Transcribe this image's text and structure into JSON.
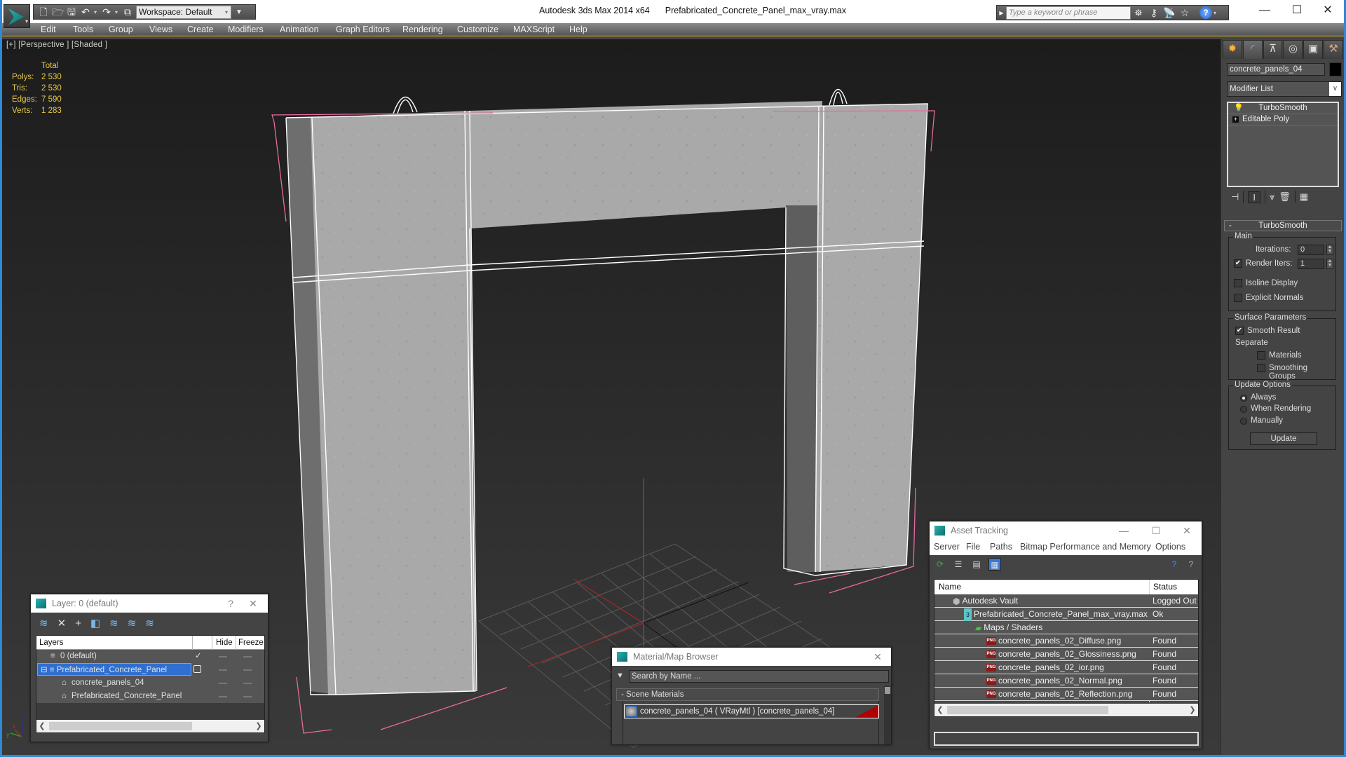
{
  "titlebar": {
    "app_title": "Autodesk 3ds Max  2014 x64",
    "file_name": "Prefabricated_Concrete_Panel_max_vray.max",
    "workspace_label": "Workspace: Default",
    "search_placeholder": "Type a keyword or phrase",
    "quick_access_icons": [
      "new-file-icon",
      "open-file-icon",
      "save-icon",
      "undo-icon",
      "redo-icon",
      "project-folder-icon"
    ],
    "info_icons": [
      "binoculars-icon",
      "key-icon",
      "satellite-icon",
      "star-icon",
      "help-icon"
    ],
    "window_controls": [
      "minimize",
      "maximize",
      "close"
    ]
  },
  "menu": {
    "items": [
      "Edit",
      "Tools",
      "Group",
      "Views",
      "Create",
      "Modifiers",
      "Animation",
      "Graph Editors",
      "Rendering",
      "Customize",
      "MAXScript",
      "Help"
    ]
  },
  "viewport": {
    "label": "[+] [Perspective ] [Shaded ]",
    "stats": {
      "header": "Total",
      "rows": [
        {
          "label": "Polys:",
          "value": "2 530"
        },
        {
          "label": "Tris:",
          "value": "2 530"
        },
        {
          "label": "Edges:",
          "value": "7 590"
        },
        {
          "label": "Verts:",
          "value": "1 283"
        }
      ]
    },
    "axis_labels": {
      "x": "x",
      "y": "y",
      "z": "z"
    },
    "colors": {
      "stats": "#e6c84a",
      "selection_bracket": "#e86aa0",
      "wire": "#ffffff"
    }
  },
  "command_panel": {
    "tabs": [
      "create",
      "modify",
      "hierarchy",
      "motion",
      "display",
      "utilities"
    ],
    "object_name": "concrete_panels_04",
    "object_color": "#000000",
    "modifier_list_label": "Modifier List",
    "stack": [
      {
        "name": "TurboSmooth",
        "icon": "lightbulb-icon"
      },
      {
        "name": "Editable Poly",
        "icon": "expand-plus-icon"
      }
    ],
    "rollout": {
      "title": "TurboSmooth",
      "main_group": "Main",
      "iterations_label": "Iterations:",
      "iterations_value": "0",
      "render_iters_label": "Render Iters:",
      "render_iters_value": "1",
      "render_iters_checked": true,
      "isoline_label": "Isoline Display",
      "isoline_checked": false,
      "explicit_normals_label": "Explicit Normals",
      "explicit_normals_checked": false,
      "surface_group": "Surface Parameters",
      "smooth_result_label": "Smooth Result",
      "smooth_result_checked": true,
      "separate_label": "Separate",
      "materials_label": "Materials",
      "materials_checked": false,
      "smoothing_groups_label": "Smoothing Groups",
      "smoothing_groups_checked": false,
      "update_group": "Update Options",
      "update_options": [
        "Always",
        "When Rendering",
        "Manually"
      ],
      "update_selected": "Always",
      "update_button": "Update"
    }
  },
  "layer_dialog": {
    "title": "Layer: 0 (default)",
    "help": "?",
    "columns": [
      "Layers",
      "Hide",
      "Freeze"
    ],
    "rows": [
      {
        "name": "0 (default)",
        "indent": 1,
        "icon": "layer-icon",
        "active": true,
        "selected": false
      },
      {
        "name": "Prefabricated_Concrete_Panel",
        "indent": 0,
        "icon": "layer-icon",
        "active": false,
        "selected": true
      },
      {
        "name": "concrete_panels_04",
        "indent": 2,
        "icon": "object-icon",
        "active": false,
        "selected": false
      },
      {
        "name": "Prefabricated_Concrete_Panel",
        "indent": 2,
        "icon": "object-icon",
        "active": false,
        "selected": false
      }
    ]
  },
  "material_browser": {
    "title": "Material/Map Browser",
    "search_placeholder": "Search by Name ...",
    "category": "- Scene Materials",
    "items": [
      "concrete_panels_04  ( VRayMtl )  [concrete_panels_04]"
    ]
  },
  "asset_tracking": {
    "title": "Asset Tracking",
    "menu": [
      "Server",
      "File",
      "Paths",
      "Bitmap Performance and Memory",
      "Options"
    ],
    "columns": [
      "Name",
      "Status"
    ],
    "rows": [
      {
        "name": "Autodesk Vault",
        "status": "Logged Out",
        "indent": 1,
        "icon": "vault-icon"
      },
      {
        "name": "Prefabricated_Concrete_Panel_max_vray.max",
        "status": "Ok",
        "indent": 2,
        "icon": "max-file-icon"
      },
      {
        "name": "Maps / Shaders",
        "status": "",
        "indent": 3,
        "icon": "maps-icon"
      },
      {
        "name": "concrete_panels_02_Diffuse.png",
        "status": "Found",
        "indent": 4,
        "icon": "png-icon"
      },
      {
        "name": "concrete_panels_02_Glossiness.png",
        "status": "Found",
        "indent": 4,
        "icon": "png-icon"
      },
      {
        "name": "concrete_panels_02_ior.png",
        "status": "Found",
        "indent": 4,
        "icon": "png-icon"
      },
      {
        "name": "concrete_panels_02_Normal.png",
        "status": "Found",
        "indent": 4,
        "icon": "png-icon"
      },
      {
        "name": "concrete_panels_02_Reflection.png",
        "status": "Found",
        "indent": 4,
        "icon": "png-icon"
      }
    ]
  }
}
